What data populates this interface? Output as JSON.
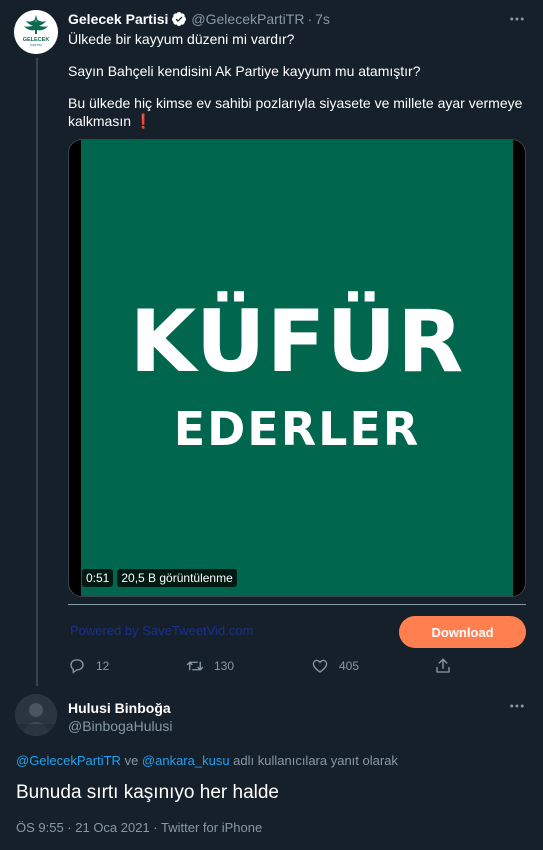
{
  "tweet1": {
    "author_name": "Gelecek Partisi",
    "handle": "@GelecekPartiTR",
    "separator": "·",
    "time": "7s",
    "avatar_text": "GELECEK",
    "avatar_subtext": "PARTİSİ",
    "lines": [
      "Ülkede bir kayyum düzeni mi vardır?",
      "Sayın Bahçeli kendisini Ak Partiye kayyum mu atamıştır?",
      "Bu ülkede hiç kimse ev sahibi pozlarıyla siyasete ve millete ayar vermeye kalkmasın"
    ],
    "emoji": "❗",
    "video": {
      "big_text": "KÜFÜR",
      "small_text": "EDERLER",
      "duration": "0:51",
      "views": "20,5 B görüntülenme"
    },
    "extension": {
      "powered_text": "Powered by SaveTweetVid.com",
      "download_label": "Download"
    },
    "actions": {
      "replies": "12",
      "retweets": "130",
      "likes": "405"
    },
    "icons": [
      "verified-icon",
      "more-icon",
      "reply-icon",
      "retweet-icon",
      "like-icon",
      "share-icon"
    ]
  },
  "tweet2": {
    "author_name": "Hulusi Binboğa",
    "handle": "@BinbogaHulusi",
    "reply_mention_1": "@GelecekPartiTR",
    "reply_conj": " ve ",
    "reply_mention_2": "@ankara_kusu",
    "reply_suffix": " adlı kullanıcılara yanıt olarak",
    "text": "Bunuda sırtı kaşınıyo her halde",
    "meta": "ÖS 9:55 · 21 Oca 2021 · Twitter for iPhone"
  },
  "colors": {
    "background": "#15202b",
    "muted": "#8899a6",
    "link": "#1da1f2",
    "video_green": "#00664d",
    "download": "#ff7f50",
    "verified": "#1da1f2"
  }
}
